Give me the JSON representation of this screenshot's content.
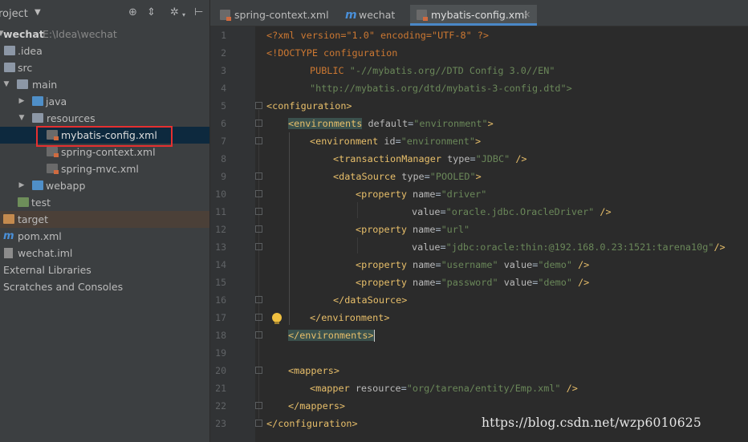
{
  "project_panel": {
    "title": "roject",
    "tree": [
      {
        "label": "wechat",
        "path": "E:\\Idea\\wechat"
      },
      {
        "label": ".idea"
      },
      {
        "label": "src"
      },
      {
        "label": "main"
      },
      {
        "label": "java"
      },
      {
        "label": "resources"
      },
      {
        "label": "mybatis-config.xml"
      },
      {
        "label": "spring-context.xml"
      },
      {
        "label": "spring-mvc.xml"
      },
      {
        "label": "webapp"
      },
      {
        "label": "test"
      },
      {
        "label": "target"
      },
      {
        "label": "pom.xml"
      },
      {
        "label": "wechat.iml"
      },
      {
        "label": "External Libraries"
      },
      {
        "label": "Scratches and Consoles"
      }
    ]
  },
  "tabs": [
    {
      "label": "spring-context.xml"
    },
    {
      "label": "wechat"
    },
    {
      "label": "mybatis-config.xml",
      "active": true
    }
  ],
  "editor": {
    "line_numbers": [
      "1",
      "2",
      "3",
      "4",
      "5",
      "6",
      "7",
      "8",
      "9",
      "10",
      "11",
      "12",
      "13",
      "14",
      "15",
      "16",
      "17",
      "18",
      "19",
      "20",
      "21",
      "22",
      "23"
    ],
    "xml": {
      "decl": "<?xml version=\"1.0\" encoding=\"UTF-8\" ?>",
      "doctype": "<!DOCTYPE configuration",
      "public_kw": "PUBLIC",
      "public_id": "\"-//mybatis.org//DTD Config 3.0//EN\"",
      "dtd_url": "\"http://mybatis.org/dtd/mybatis-3-config.dtd\">",
      "configuration_open": "<configuration>",
      "environments_open": "<environments",
      "default_attr": "default",
      "default_val": "\"environment\"",
      "environment_open": "<environment",
      "id_attr": "id",
      "id_val": "\"environment\"",
      "tm_open": "<transactionManager",
      "type_attr": "type",
      "tm_type_val": "\"JDBC\"",
      "self_close": "/>",
      "ds_open": "<dataSource",
      "ds_type_val": "\"POOLED\"",
      "property_open": "<property",
      "name_attr": "name",
      "value_attr": "value",
      "driver_name": "\"driver\"",
      "driver_value": "\"oracle.jdbc.OracleDriver\"",
      "url_name": "\"url\"",
      "url_value": "\"jdbc:oracle:thin:@192.168.0.23:1521:tarena10g\"",
      "username_name": "\"username\"",
      "username_value": "\"demo\"",
      "password_name": "\"password\"",
      "password_value": "\"demo\"",
      "ds_close": "</dataSource>",
      "environment_close": "</environment>",
      "environments_close": "</environments>",
      "mappers_open": "<mappers>",
      "mapper_open": "<mapper",
      "resource_attr": "resource",
      "mapper_resource": "\"org/tarena/entity/Emp.xml\"",
      "mappers_close": "</mappers>",
      "configuration_close": "</configuration>",
      "gt": ">"
    }
  },
  "watermark": "https://blog.csdn.net/wzp6010625",
  "colors": {
    "tag": "#e8bf6a",
    "string": "#6a8759",
    "keyword": "#cc7832",
    "selection_box": "#e53030",
    "accent": "#4a88c7"
  }
}
